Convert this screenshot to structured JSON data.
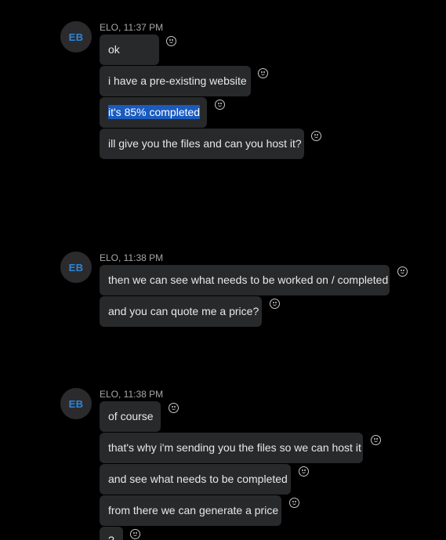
{
  "groups": [
    {
      "avatar": "EB",
      "meta": "ELO, 11:37 PM",
      "messages": [
        {
          "text": "ok"
        },
        {
          "text": "i have a pre-existing website"
        },
        {
          "text": "it's 85% completed"
        },
        {
          "text": "ill give you the files and can you host it?"
        }
      ]
    },
    {
      "avatar": "EB",
      "meta": "ELO, 11:38 PM",
      "messages": [
        {
          "text": "then we can see what needs to be worked on / completed"
        },
        {
          "text": "and you can quote me a price?"
        }
      ]
    },
    {
      "avatar": "EB",
      "meta": "ELO, 11:38 PM",
      "messages": [
        {
          "text": "of course"
        },
        {
          "text": "that's why i'm sending you the files so we can host it"
        },
        {
          "text": "and see what needs to be completed"
        },
        {
          "text": "from there we can generate a price"
        },
        {
          "text": "?"
        }
      ]
    }
  ],
  "icons": {
    "reaction": "smiley-face-icon"
  },
  "colors": {
    "background": "#000000",
    "bubble": "#28292b",
    "avatar_text": "#2f86d8",
    "selection": "#1a5bbf"
  }
}
